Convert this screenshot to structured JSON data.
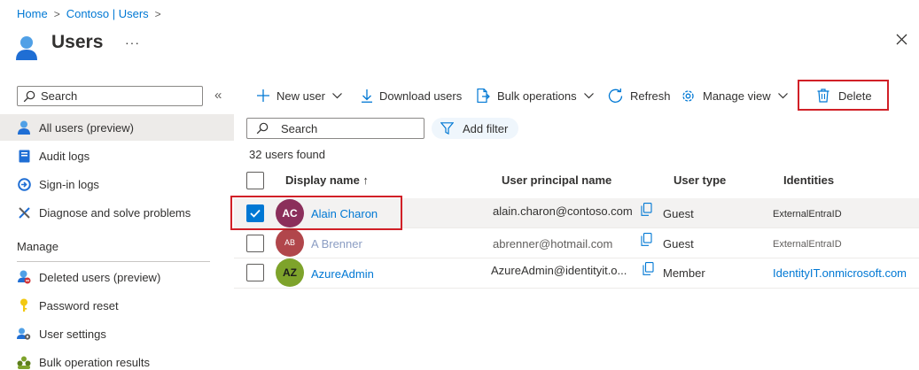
{
  "breadcrumb": [
    "Home",
    "Contoso | Users"
  ],
  "page": {
    "title": "Users",
    "more": "···"
  },
  "sidebar": {
    "search_placeholder": "Search",
    "items": [
      {
        "label": "All users (preview)",
        "icon": "user-icon",
        "active": true
      },
      {
        "label": "Audit logs",
        "icon": "audit-log-icon"
      },
      {
        "label": "Sign-in logs",
        "icon": "sign-in-icon"
      },
      {
        "label": "Diagnose and solve problems",
        "icon": "wrench-icon"
      }
    ],
    "manage_heading": "Manage",
    "manage_items": [
      {
        "label": "Deleted users (preview)",
        "icon": "deleted-user-icon"
      },
      {
        "label": "Password reset",
        "icon": "key-icon"
      },
      {
        "label": "User settings",
        "icon": "user-settings-icon"
      },
      {
        "label": "Bulk operation results",
        "icon": "bulk-results-icon"
      }
    ]
  },
  "toolbar": {
    "new_user": "New user",
    "download_users": "Download users",
    "bulk_operations": "Bulk operations",
    "refresh": "Refresh",
    "manage_view": "Manage view",
    "delete": "Delete"
  },
  "grid": {
    "search_placeholder": "Search",
    "add_filter": "Add filter",
    "count": "32 users found",
    "columns": [
      "Display name ↑",
      "User principal name",
      "User type",
      "Identities"
    ],
    "rows": [
      {
        "initials": "AC",
        "avatar_color": "#8b2f5b",
        "name": "Alain Charon",
        "upn": "alain.charon@contoso.com",
        "type": "Guest",
        "identities": "ExternalEntraID",
        "selected": true
      },
      {
        "initials": "AB",
        "avatar_color": "#a4262c",
        "name": "A Brenner",
        "upn": "abrenner@hotmail.com",
        "type": "Guest",
        "identities": "ExternalEntraID",
        "selected": false
      },
      {
        "initials": "AZ",
        "avatar_color": "#7ea32b",
        "name": "AzureAdmin",
        "upn": "AzureAdmin@identityit.o...",
        "type": "Member",
        "identities": "IdentityIT.onmicrosoft.com",
        "selected": false
      }
    ]
  },
  "colors": {
    "accent": "#0078d4",
    "highlight": "#d12027"
  }
}
